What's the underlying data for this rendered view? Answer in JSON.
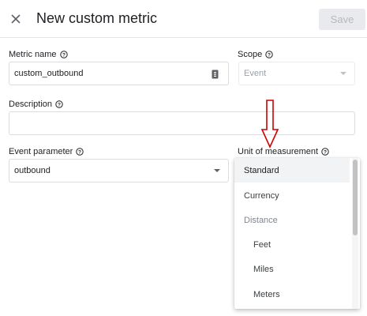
{
  "header": {
    "title": "New custom metric",
    "save_label": "Save"
  },
  "form": {
    "metric_name": {
      "label": "Metric name",
      "value": "custom_outbound"
    },
    "scope": {
      "label": "Scope",
      "value": "Event"
    },
    "description": {
      "label": "Description",
      "value": ""
    },
    "event_parameter": {
      "label": "Event parameter",
      "value": "outbound"
    },
    "unit_of_measurement": {
      "label": "Unit of measurement"
    }
  },
  "dropdown": {
    "options": [
      {
        "label": "Standard",
        "state": "selected"
      },
      {
        "label": "Currency",
        "state": "normal"
      },
      {
        "label": "Distance",
        "state": "group-header"
      },
      {
        "label": "Feet",
        "state": "indented"
      },
      {
        "label": "Miles",
        "state": "indented"
      },
      {
        "label": "Meters",
        "state": "indented"
      }
    ]
  },
  "icons": {
    "close": "close-icon",
    "help": "help-circle-icon",
    "field_hint": "contact-card-icon",
    "annotation": "red-down-arrow"
  },
  "colors": {
    "annotation_arrow": "#cc0000",
    "save_disabled_bg": "#e8eaed"
  }
}
